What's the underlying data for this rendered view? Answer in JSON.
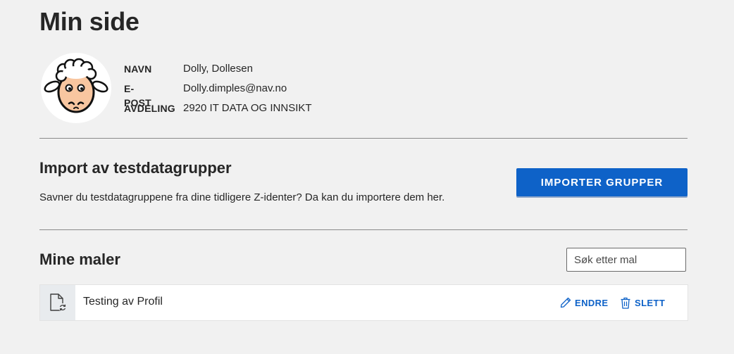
{
  "page": {
    "title": "Min side"
  },
  "profile": {
    "rows": [
      {
        "key": "NAVN",
        "value": "Dolly, Dollesen"
      },
      {
        "key": "E-POST",
        "value": "Dolly.dimples@nav.no"
      },
      {
        "key": "AVDELING",
        "value": "2920 IT DATA OG INNSIKT"
      }
    ]
  },
  "import": {
    "title": "Import av testdatagrupper",
    "description": "Savner du testdatagruppene fra dine tidligere Z-identer? Da kan du importere dem her.",
    "button_label": "IMPORTER GRUPPER"
  },
  "maler": {
    "title": "Mine maler",
    "search": {
      "placeholder": "Søk etter mal",
      "value": ""
    },
    "items": [
      {
        "name": "Testing av Profil",
        "edit_label": "ENDRE",
        "delete_label": "SLETT"
      }
    ]
  },
  "colors": {
    "accent": "#0e62c8",
    "background": "#f1f1f1"
  }
}
